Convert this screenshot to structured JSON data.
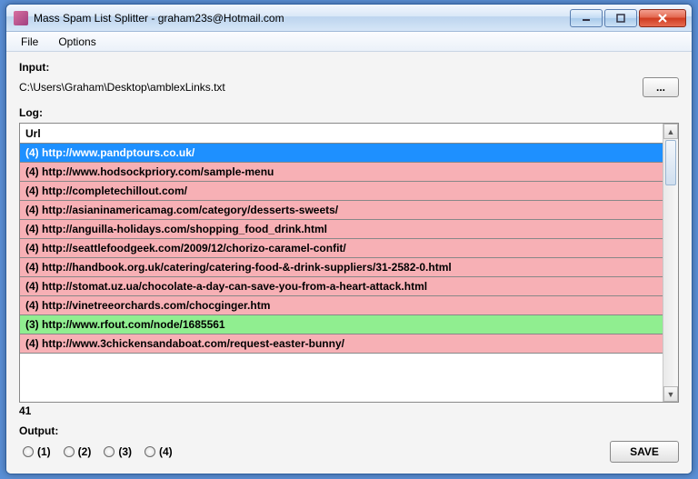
{
  "window": {
    "title": "Mass Spam List Splitter - graham23s@Hotmail.com"
  },
  "menu": {
    "file": "File",
    "options": "Options"
  },
  "input": {
    "label": "Input:",
    "path": "C:\\Users\\Graham\\Desktop\\amblexLinks.txt",
    "browse": "..."
  },
  "log": {
    "label": "Log:",
    "header": "Url",
    "rows": [
      {
        "text": "(4) http://www.pandptours.co.uk/",
        "style": "sel"
      },
      {
        "text": "(4) http://www.hodsockpriory.com/sample-menu",
        "style": "pink"
      },
      {
        "text": "(4) http://completechillout.com/",
        "style": "pink"
      },
      {
        "text": "(4) http://asianinamericamag.com/category/desserts-sweets/",
        "style": "pink"
      },
      {
        "text": "(4) http://anguilla-holidays.com/shopping_food_drink.html",
        "style": "pink"
      },
      {
        "text": "(4) http://seattlefoodgeek.com/2009/12/chorizo-caramel-confit/",
        "style": "pink"
      },
      {
        "text": "(4) http://handbook.org.uk/catering/catering-food-&-drink-suppliers/31-2582-0.html",
        "style": "pink"
      },
      {
        "text": "(4) http://stomat.uz.ua/chocolate-a-day-can-save-you-from-a-heart-attack.html",
        "style": "pink"
      },
      {
        "text": "(4) http://vinetreeorchards.com/chocginger.htm",
        "style": "pink"
      },
      {
        "text": "(3) http://www.rfout.com/node/1685561",
        "style": "green"
      },
      {
        "text": "(4) http://www.3chickensandaboat.com/request-easter-bunny/",
        "style": "pink"
      }
    ],
    "count": "41"
  },
  "output": {
    "label": "Output:",
    "options": [
      "(1)",
      "(2)",
      "(3)",
      "(4)"
    ],
    "save": "SAVE"
  }
}
